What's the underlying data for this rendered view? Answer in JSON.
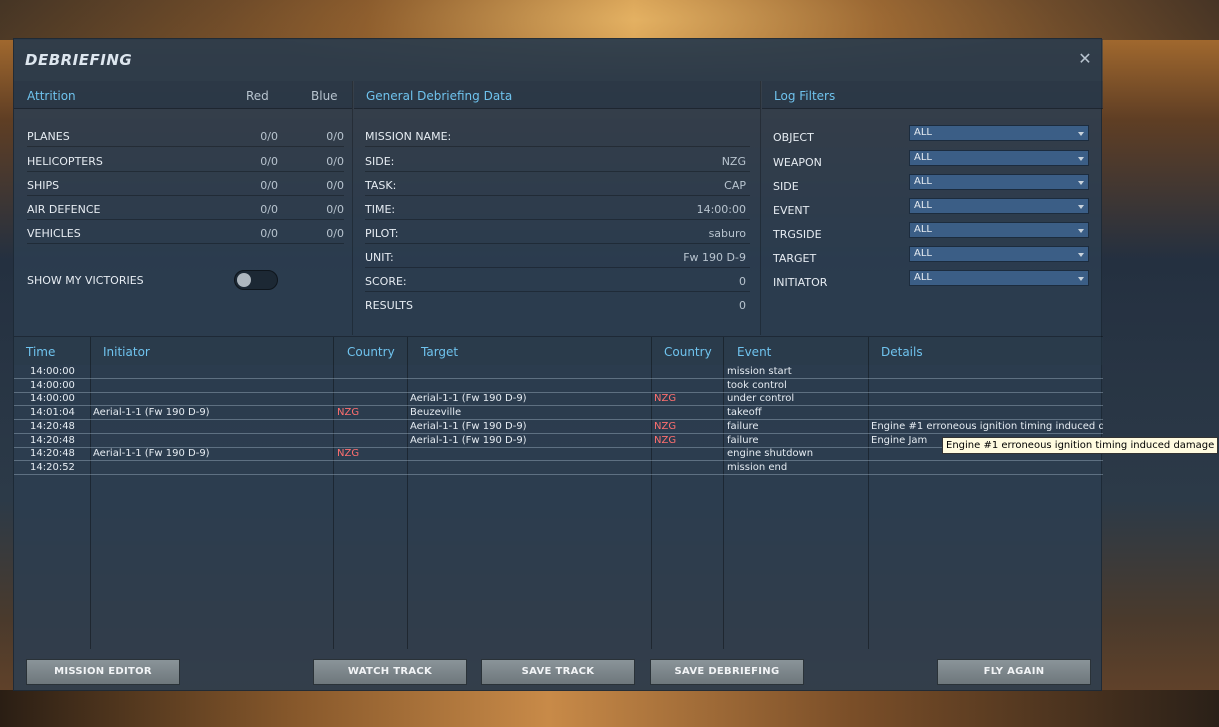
{
  "window": {
    "title": "DEBRIEFING",
    "close_glyph": "✕"
  },
  "attrition": {
    "header": "Attrition",
    "col_red": "Red",
    "col_blue": "Blue",
    "rows": [
      {
        "label": "PLANES",
        "red": "0/0",
        "blue": "0/0"
      },
      {
        "label": "HELICOPTERS",
        "red": "0/0",
        "blue": "0/0"
      },
      {
        "label": "SHIPS",
        "red": "0/0",
        "blue": "0/0"
      },
      {
        "label": "AIR DEFENCE",
        "red": "0/0",
        "blue": "0/0"
      },
      {
        "label": "VEHICLES",
        "red": "0/0",
        "blue": "0/0"
      }
    ],
    "show_victories_label": "SHOW MY VICTORIES",
    "show_victories_on": false
  },
  "general": {
    "header": "General Debriefing Data",
    "rows": [
      {
        "label": "MISSION NAME:",
        "value": ""
      },
      {
        "label": "SIDE:",
        "value": "NZG"
      },
      {
        "label": "TASK:",
        "value": "CAP"
      },
      {
        "label": "TIME:",
        "value": "14:00:00"
      },
      {
        "label": "PILOT:",
        "value": "saburo"
      },
      {
        "label": "UNIT:",
        "value": "Fw 190 D-9"
      },
      {
        "label": "SCORE:",
        "value": "0"
      },
      {
        "label": "RESULTS",
        "value": "0"
      }
    ]
  },
  "log_filters": {
    "header": "Log Filters",
    "rows": [
      {
        "label": "OBJECT",
        "value": "ALL"
      },
      {
        "label": "WEAPON",
        "value": "ALL"
      },
      {
        "label": "SIDE",
        "value": "ALL"
      },
      {
        "label": "EVENT",
        "value": "ALL"
      },
      {
        "label": "TRGSIDE",
        "value": "ALL"
      },
      {
        "label": "TARGET",
        "value": "ALL"
      },
      {
        "label": "INITIATOR",
        "value": "ALL"
      }
    ]
  },
  "log": {
    "columns": {
      "time": "Time",
      "initiator": "Initiator",
      "country1": "Country",
      "target": "Target",
      "country2": "Country",
      "event": "Event",
      "details": "Details"
    },
    "rows": [
      {
        "time": "14:00:00",
        "initiator": "",
        "country1": "",
        "target": "",
        "country2": "",
        "event": "mission start",
        "details": ""
      },
      {
        "time": "14:00:00",
        "initiator": "",
        "country1": "",
        "target": "",
        "country2": "",
        "event": "took control",
        "details": ""
      },
      {
        "time": "14:00:00",
        "initiator": "",
        "country1": "",
        "target": "Aerial-1-1 (Fw 190 D-9)",
        "country2": "NZG",
        "event": "under control",
        "details": ""
      },
      {
        "time": "14:01:04",
        "initiator": "Aerial-1-1 (Fw 190 D-9)",
        "country1": "NZG",
        "target": "Beuzeville",
        "country2": "",
        "event": "takeoff",
        "details": ""
      },
      {
        "time": "14:20:48",
        "initiator": "",
        "country1": "",
        "target": "Aerial-1-1 (Fw 190 D-9)",
        "country2": "NZG",
        "event": "failure",
        "details": "Engine #1 erroneous ignition timing induced dam"
      },
      {
        "time": "14:20:48",
        "initiator": "",
        "country1": "",
        "target": "Aerial-1-1 (Fw 190 D-9)",
        "country2": "NZG",
        "event": "failure",
        "details": "Engine Jam"
      },
      {
        "time": "14:20:48",
        "initiator": "Aerial-1-1 (Fw 190 D-9)",
        "country1": "NZG",
        "target": "",
        "country2": "",
        "event": "engine shutdown",
        "details": ""
      },
      {
        "time": "14:20:52",
        "initiator": "",
        "country1": "",
        "target": "",
        "country2": "",
        "event": "mission end",
        "details": ""
      }
    ],
    "tooltip": "Engine #1 erroneous ignition timing induced damage"
  },
  "buttons": {
    "mission_editor": "MISSION EDITOR",
    "watch_track": "WATCH TRACK",
    "save_track": "SAVE TRACK",
    "save_debriefing": "SAVE DEBRIEFING",
    "fly_again": "FLY AGAIN"
  }
}
